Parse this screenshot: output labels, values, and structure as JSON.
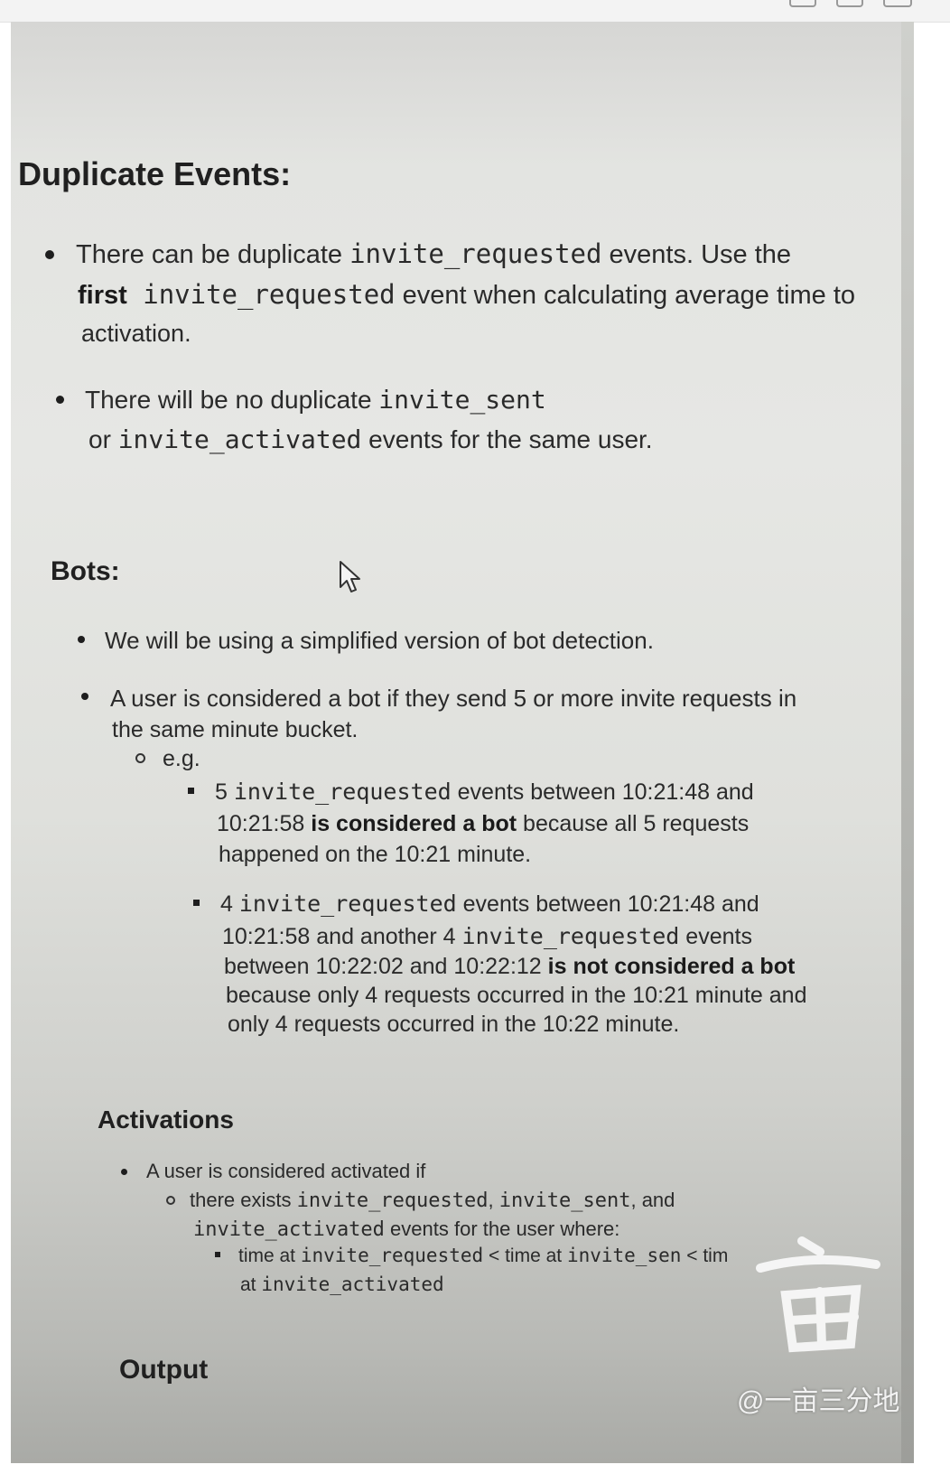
{
  "window": {
    "title": "",
    "controls": [
      "minimize-icon",
      "maximize-icon",
      "close-icon"
    ]
  },
  "duplicate_events": {
    "heading": "Duplicate Events:",
    "item1": {
      "line1_a": "There can be duplicate ",
      "line1_code": "invite_requested",
      "line1_b": " events. Use the",
      "line2_bold": "first",
      "line2_code": " invite_requested",
      "line2_b": " event when calculating average time to",
      "line3": "activation."
    },
    "item2": {
      "line1_a": "There will be no duplicate ",
      "line1_code": "invite_sent",
      "line2_a": "or ",
      "line2_code": "invite_activated",
      "line2_b": " events for the same user."
    }
  },
  "bots": {
    "heading": "Bots:",
    "item1": "We will be using a simplified version of bot detection.",
    "item2_line1": "A user is considered a bot if they send 5 or more invite requests in",
    "item2_line2": "the same minute bucket.",
    "eg": "e.g.",
    "ex1": {
      "l1_a": "5 ",
      "l1_code": "invite_requested",
      "l1_b": " events between 10:21:48 and",
      "l2_a": "10:21:58 ",
      "l2_bold": "is considered a bot",
      "l2_b": " because all 5 requests",
      "l3": "happened on the 10:21 minute."
    },
    "ex2": {
      "l1_a": "4 ",
      "l1_code": "invite_requested",
      "l1_b": " events between 10:21:48 and",
      "l2_a": "10:21:58 and another 4 ",
      "l2_code": "invite_requested",
      "l2_b": " events",
      "l3_a": "between 10:22:02 and 10:22:12 ",
      "l3_bold": "is not considered a bot",
      "l4": "because only 4 requests occurred in the 10:21 minute and",
      "l5": "only 4 requests occurred in the 10:22 minute."
    }
  },
  "activations": {
    "heading": "Activations",
    "item1": "A user is considered activated if",
    "sub1_a": "there exists ",
    "sub1_code1": "invite_requested",
    "sub1_b": ", ",
    "sub1_code2": "invite_sent",
    "sub1_c": ", and",
    "sub2_code": "invite_activated",
    "sub2_b": " events for the user where:",
    "cond_a": "time at ",
    "cond_code1": "invite_requested",
    "cond_b": " < time at ",
    "cond_code2": "invite_sen",
    "cond_c": " < tim",
    "cond2_a": "at ",
    "cond2_code": "invite_activated"
  },
  "output": {
    "heading": "Output"
  },
  "watermark": {
    "text": "@一亩三分地"
  },
  "colors": {
    "text": "#1e1e1e",
    "paper": "#e3e4e1"
  }
}
